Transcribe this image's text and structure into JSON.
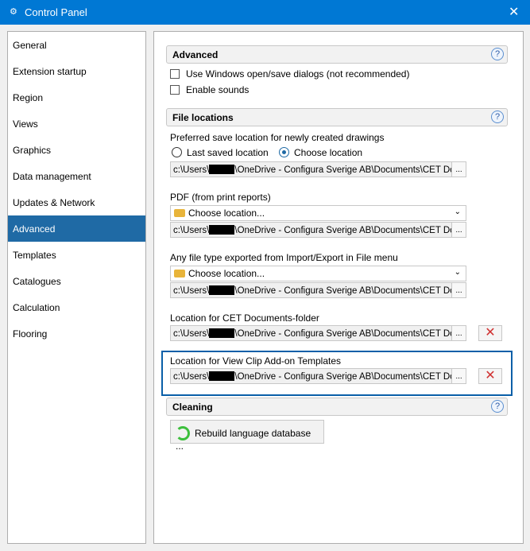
{
  "window": {
    "title": "Control Panel",
    "close": "✕",
    "app_icon": "⚙"
  },
  "sidebar": {
    "items": [
      {
        "label": "General"
      },
      {
        "label": "Extension startup"
      },
      {
        "label": "Region"
      },
      {
        "label": "Views"
      },
      {
        "label": "Graphics"
      },
      {
        "label": "Data management"
      },
      {
        "label": "Updates & Network"
      },
      {
        "label": "Advanced",
        "selected": true
      },
      {
        "label": "Templates"
      },
      {
        "label": "Catalogues"
      },
      {
        "label": "Calculation"
      },
      {
        "label": "Flooring"
      }
    ]
  },
  "advanced": {
    "title": "Advanced",
    "help": "?",
    "use_windows_dialogs": {
      "label": "Use Windows open/save dialogs (not recommended)",
      "checked": false
    },
    "enable_sounds": {
      "label": "Enable sounds",
      "checked": false
    }
  },
  "file_locations": {
    "title": "File locations",
    "help": "?",
    "preferred": {
      "label": "Preferred save location for newly created drawings",
      "radio_last": "Last saved location",
      "radio_choose": "Choose location",
      "selected": "Choose location",
      "path_a": "c:\\Users\\",
      "path_b": "\\OneDrive - Configura Sverige AB\\Documents\\CET Do",
      "browse": "..."
    },
    "pdf": {
      "label": "PDF (from print reports)",
      "dropdown": "Choose location...",
      "path_a": "c:\\Users\\",
      "path_b": "\\OneDrive - Configura Sverige AB\\Documents\\CET Do",
      "browse": "..."
    },
    "any": {
      "label": "Any file type exported from Import/Export in File menu",
      "dropdown": "Choose location...",
      "path_a": "c:\\Users\\",
      "path_b": "\\OneDrive - Configura Sverige AB\\Documents\\CET Do",
      "browse": "..."
    },
    "cet_docs": {
      "label": "Location for CET Documents-folder",
      "path_a": "c:\\Users\\",
      "path_b": "\\OneDrive - Configura Sverige AB\\Documents\\CET Do",
      "browse": "...",
      "delete": "✕"
    },
    "view_clip": {
      "label": "Location for View Clip Add-on Templates",
      "path_a": "c:\\Users\\",
      "path_b": "\\OneDrive - Configura Sverige AB\\Documents\\CET Do",
      "browse": "...",
      "delete": "✕"
    }
  },
  "cleaning": {
    "title": "Cleaning",
    "help": "?",
    "rebuild": "Rebuild language database ..."
  },
  "colors": {
    "titlebar": "#0078d4",
    "selected": "#1f6aa5",
    "highlight": "#0a5fa8"
  }
}
